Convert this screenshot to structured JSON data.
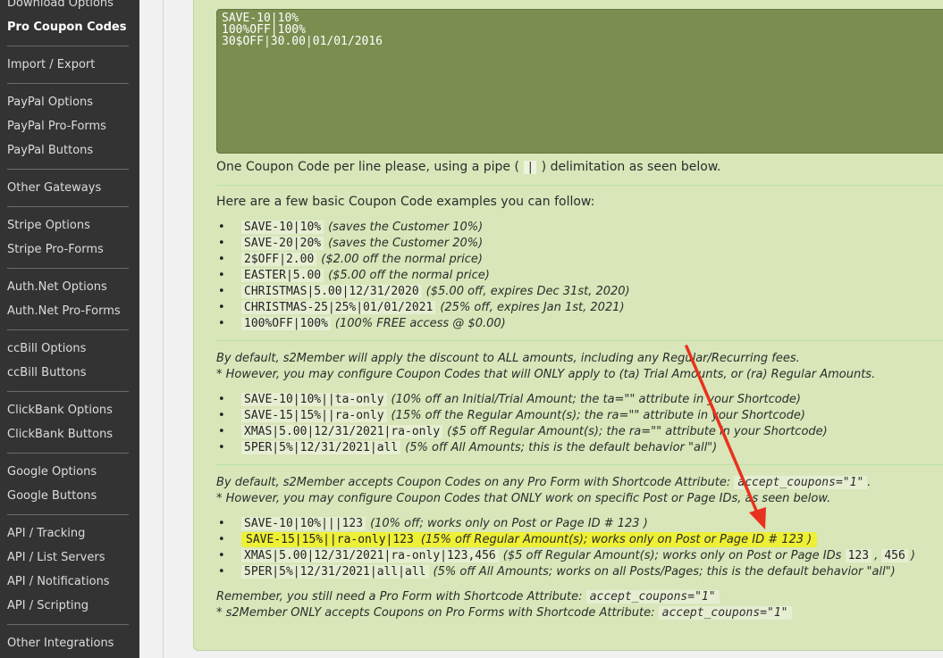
{
  "sidebar": {
    "items": [
      {
        "label": "Download Options"
      },
      {
        "label": "Pro Coupon Codes"
      },
      {
        "label": "Import / Export"
      },
      {
        "label": "PayPal Options"
      },
      {
        "label": "PayPal Pro-Forms"
      },
      {
        "label": "PayPal Buttons"
      },
      {
        "label": "Other Gateways"
      },
      {
        "label": "Stripe Options"
      },
      {
        "label": "Stripe Pro-Forms"
      },
      {
        "label": "Auth.Net Options"
      },
      {
        "label": "Auth.Net Pro-Forms"
      },
      {
        "label": "ccBill Options"
      },
      {
        "label": "ccBill Buttons"
      },
      {
        "label": "ClickBank Options"
      },
      {
        "label": "ClickBank Buttons"
      },
      {
        "label": "Google Options"
      },
      {
        "label": "Google Buttons"
      },
      {
        "label": "API / Tracking"
      },
      {
        "label": "API / List Servers"
      },
      {
        "label": "API / Notifications"
      },
      {
        "label": "API / Scripting"
      },
      {
        "label": "Other Integrations"
      }
    ]
  },
  "textarea": {
    "value": "SAVE-10|10%\n100%OFF|100%\n30$OFF|30.00|01/01/2016"
  },
  "intro": {
    "line_before": "One Coupon Code per line please, using a pipe (",
    "pipe": "|",
    "line_after": ") delimitation as seen below.",
    "examples_heading": "Here are a few basic Coupon Code examples you can follow:"
  },
  "basic_examples": [
    {
      "code": "SAVE-10|10%",
      "desc": "(saves the Customer 10%)"
    },
    {
      "code": "SAVE-20|20%",
      "desc": "(saves the Customer 20%)"
    },
    {
      "code": "2$OFF|2.00",
      "desc": "($2.00 off the normal price)"
    },
    {
      "code": "EASTER|5.00",
      "desc": "($5.00 off the normal price)"
    },
    {
      "code": "CHRISTMAS|5.00|12/31/2020",
      "desc": "($5.00 off, expires Dec 31st, 2020)"
    },
    {
      "code": "CHRISTMAS-25|25%|01/01/2021",
      "desc": "(25% off, expires Jan 1st, 2021)"
    },
    {
      "code": "100%OFF|100%",
      "desc": "(100% FREE access @ $0.00)"
    }
  ],
  "amounts": {
    "line1": "By default, s2Member will apply the discount to ALL amounts, including any Regular/Recurring fees.",
    "line2": "* However, you may configure Coupon Codes that will ONLY apply to (ta) Trial Amounts, or (ra) Regular Amounts.",
    "examples": [
      {
        "code": "SAVE-10|10%||ta-only",
        "desc": "(10% off an Initial/Trial Amount; the ta=\"\" attribute in your Shortcode)"
      },
      {
        "code": "SAVE-15|15%||ra-only",
        "desc": "(15% off the Regular Amount(s); the ra=\"\" attribute in your Shortcode)"
      },
      {
        "code": "XMAS|5.00|12/31/2021|ra-only",
        "desc": "($5 off Regular Amount(s); the ra=\"\" attribute in your Shortcode)"
      },
      {
        "code": "5PER|5%|12/31/2021|all",
        "desc": "(5% off All Amounts; this is the default behavior \"all\")"
      }
    ]
  },
  "posts": {
    "line1_before": "By default, s2Member accepts Coupon Codes on any Pro Form with Shortcode Attribute:",
    "attr_code": "accept_coupons=\"1\"",
    "line1_after": ".",
    "line2": "* However, you may configure Coupon Codes that ONLY work on specific Post or Page IDs, as seen below.",
    "examples": [
      {
        "code": "SAVE-10|10%|||123",
        "desc": "(10% off; works only on Post or Page ID # 123 )"
      },
      {
        "code": "SAVE-15|15%||ra-only|123",
        "desc": "(15% off Regular Amount(s); works only on Post or Page ID # 123 )"
      },
      {
        "code": "XMAS|5.00|12/31/2021|ra-only|123,456",
        "desc_before": "($5 off Regular Amount(s); works only on Post or Page IDs",
        "ids_a": "123",
        "comma": ",",
        "ids_b": "456",
        "desc_after": ")"
      },
      {
        "code": "5PER|5%|12/31/2021|all|all",
        "desc": "(5% off All Amounts; works on all Posts/Pages; this is the default behavior \"all\")"
      }
    ]
  },
  "remember": {
    "line1_before": "Remember, you still need a Pro Form with Shortcode Attribute:",
    "line1_code": "accept_coupons=\"1\"",
    "line2_before": "* s2Member ONLY accepts Coupons on Pro Forms with Shortcode Attribute:",
    "line2_code": "accept_coupons=\"1\""
  },
  "colors": {
    "panel": "#d8e6b9",
    "textarea": "#7b8e50",
    "highlight": "#eef035",
    "arrow": "#e8321e",
    "sidebar": "#333333"
  }
}
